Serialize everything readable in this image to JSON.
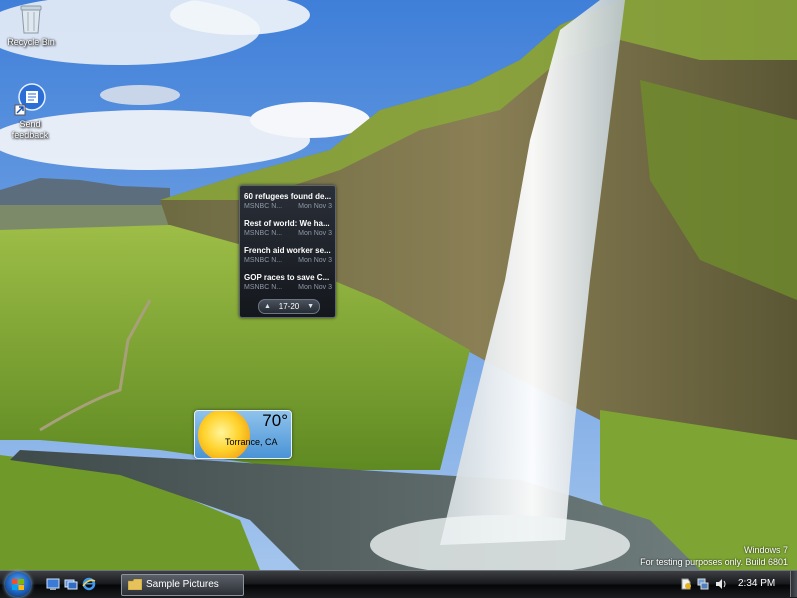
{
  "desktop": {
    "icons": [
      {
        "label": "Recycle Bin",
        "icon": "recycle-bin-icon"
      },
      {
        "label": "Send feedback",
        "icon": "send-feedback-icon"
      }
    ]
  },
  "news_gadget": {
    "items": [
      {
        "title": "60 refugees found de...",
        "source": "MSNBC N...",
        "date": "Mon Nov 3"
      },
      {
        "title": "Rest of world: We ha...",
        "source": "MSNBC N...",
        "date": "Mon Nov 3"
      },
      {
        "title": "French aid worker se...",
        "source": "MSNBC N...",
        "date": "Mon Nov 3"
      },
      {
        "title": "GOP races to save C...",
        "source": "MSNBC N...",
        "date": "Mon Nov 3"
      }
    ],
    "pager": {
      "range": "17-20",
      "prev_icon": "up-arrow-icon",
      "next_icon": "down-arrow-icon"
    }
  },
  "weather_gadget": {
    "temperature": "70°",
    "location": "Torrance, CA",
    "condition_icon": "sun-icon"
  },
  "watermark": {
    "line1": "Windows 7",
    "line2": "For testing purposes only. Build 6801"
  },
  "taskbar": {
    "start_icon": "windows-logo-icon",
    "quick_launch": [
      "show-desktop-icon",
      "switch-windows-icon",
      "internet-explorer-icon"
    ],
    "tasks": [
      {
        "label": "Sample Pictures",
        "icon": "folder-icon"
      }
    ],
    "tray_icons": [
      "action-center-icon",
      "network-icon",
      "volume-icon"
    ],
    "clock": "2:34 PM"
  },
  "colors": {
    "taskbar": "#16181b",
    "sky": "#5b93dd",
    "grass": "#8fb53a"
  }
}
